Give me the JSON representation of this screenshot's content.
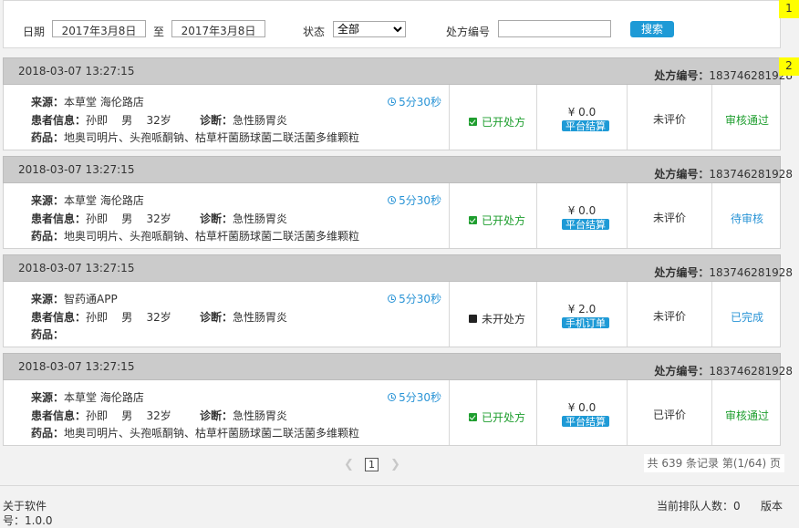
{
  "filter": {
    "date_label": "日期",
    "date_from": "2017年3月8日",
    "to_label": "至",
    "date_to": "2017年3月8日",
    "status_label": "状态",
    "status_value": "全部",
    "rx_label": "处方编号",
    "rx_value": "",
    "search_label": "搜索"
  },
  "markers": [
    "1",
    "2"
  ],
  "orders": [
    {
      "datetime": "2018-03-07  13:27:15",
      "rx_label": "处方编号：",
      "rx_number": "183746281928",
      "source_label": "来源：",
      "source": "本草堂 海伦路店",
      "patient_label": "患者信息：",
      "patient": "孙即    男    32岁",
      "diagnosis_label": "诊断：",
      "diagnosis": "急性肠胃炎",
      "drugs_label": "药品：",
      "drugs": "地奥司明片、头孢哌酮钠、枯草杆菌肠球菌二联活菌多维颗粒",
      "timer": "5分30秒",
      "status": "已开处方",
      "status_kind": "done",
      "price": "¥ 0.0",
      "pay_tag": "平台结算",
      "rating": "未评价",
      "audit": "审核通过",
      "audit_color": "#1f9e2f"
    },
    {
      "datetime": "2018-03-07  13:27:15",
      "rx_label": "处方编号：",
      "rx_number": "183746281928",
      "source_label": "来源：",
      "source": "本草堂 海伦路店",
      "patient_label": "患者信息：",
      "patient": "孙即    男    32岁",
      "diagnosis_label": "诊断：",
      "diagnosis": "急性肠胃炎",
      "drugs_label": "药品：",
      "drugs": "地奥司明片、头孢哌酮钠、枯草杆菌肠球菌二联活菌多维颗粒",
      "timer": "5分30秒",
      "status": "已开处方",
      "status_kind": "done",
      "price": "¥ 0.0",
      "pay_tag": "平台结算",
      "rating": "未评价",
      "audit": "待审核",
      "audit_color": "#2a94d6"
    },
    {
      "datetime": "2018-03-07  13:27:15",
      "rx_label": "处方编号：",
      "rx_number": "183746281928",
      "source_label": "来源：",
      "source": "智药通APP",
      "patient_label": "患者信息：",
      "patient": "孙即    男    32岁",
      "diagnosis_label": "诊断：",
      "diagnosis": "急性肠胃炎",
      "drugs_label": "药品：",
      "drugs": "",
      "timer": "5分30秒",
      "status": "未开处方",
      "status_kind": "pending",
      "price": "¥ 2.0",
      "pay_tag": "手机订单",
      "rating": "未评价",
      "audit": "已完成",
      "audit_color": "#2a94d6"
    },
    {
      "datetime": "2018-03-07  13:27:15",
      "rx_label": "处方编号：",
      "rx_number": "183746281928",
      "source_label": "来源：",
      "source": "本草堂 海伦路店",
      "patient_label": "患者信息：",
      "patient": "孙即    男    32岁",
      "diagnosis_label": "诊断：",
      "diagnosis": "急性肠胃炎",
      "drugs_label": "药品：",
      "drugs": "地奥司明片、头孢哌酮钠、枯草杆菌肠球菌二联活菌多维颗粒",
      "timer": "5分30秒",
      "status": "已开处方",
      "status_kind": "done",
      "price": "¥ 0.0",
      "pay_tag": "平台结算",
      "rating": "已评价",
      "audit": "审核通过",
      "audit_color": "#1f9e2f"
    }
  ],
  "pagination": {
    "current_page": "1",
    "prev_icon": "chevron-left-icon",
    "next_icon": "chevron-right-icon",
    "records_text": "共 639 条记录  第(1/64) 页"
  },
  "footer": {
    "about_line1": "关于软件",
    "about_line2": "号：1.0.0",
    "queue_text": "当前排队人数：0",
    "version_label": "版本"
  }
}
